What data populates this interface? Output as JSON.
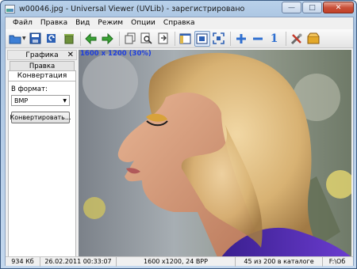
{
  "window": {
    "title": "w00046.jpg - Universal Viewer (UVLib) - зарегистрировано",
    "minimize": "—",
    "maximize": "□",
    "close": "✕"
  },
  "menu": [
    "Файл",
    "Правка",
    "Вид",
    "Режим",
    "Опции",
    "Справка"
  ],
  "toolbar": {
    "icons": [
      "open-folder-icon",
      "save-icon",
      "reload-icon",
      "trash-icon",
      "back-arrow-icon",
      "forward-arrow-icon",
      "copy-icon",
      "find-icon",
      "go-to-icon",
      "panel-view-icon",
      "fit-window-icon",
      "fullscreen-icon",
      "zoom-in-icon",
      "zoom-out-icon",
      "actual-size-icon",
      "tools-icon",
      "plugins-icon"
    ],
    "actual_size_label": "1",
    "colors": {
      "green": "#3aa335",
      "blue": "#2f6fd0"
    }
  },
  "left_panel": {
    "title": "Графика",
    "close": "✕",
    "tabs": [
      "Правка",
      "Конвертация"
    ],
    "active_tab": "Конвертация",
    "format_label": "В формат:",
    "format_value": "BMP",
    "convert_button": "Конвертировать..."
  },
  "viewer": {
    "info": "1600 x 1200 (30%)",
    "info_color": "#1f3fdc"
  },
  "status": {
    "size": "934 Кб",
    "date": "26.02.2011 00:33:07",
    "dimensions": "1600 x1200, 24 BPP",
    "position": "45 из 200 в каталоге",
    "path": "F:\\Об"
  }
}
